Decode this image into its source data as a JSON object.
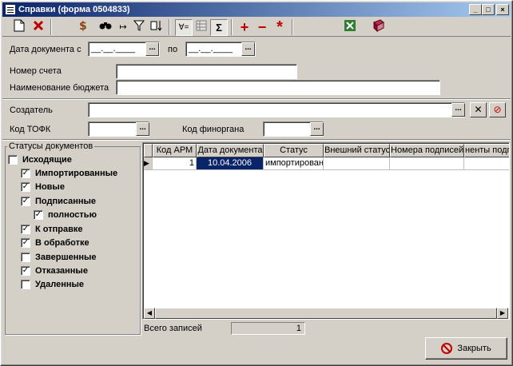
{
  "window": {
    "title": "Справки (форма 0504833)"
  },
  "toolbar": {
    "icons": [
      "new-document-icon",
      "delete-icon",
      "money-icon",
      "find-icon",
      "filter-icon",
      "sort-icon",
      "column-filter-icon",
      "grid-settings-icon",
      "sum-icon",
      "add-icon",
      "remove-icon",
      "asterisk-icon",
      "excel-icon",
      "book-icon"
    ],
    "sum_glyph": "Σ",
    "filter_glyph": "∀=",
    "add_glyph": "+",
    "remove_glyph": "−",
    "star_glyph": "*"
  },
  "form": {
    "date_label": "Дата документа с",
    "date_from_value": "__.__.____",
    "date_to_label": "по",
    "date_to_value": "__.__.____",
    "account_label": "Номер счета",
    "account_value": "",
    "budget_label": "Наименование бюджета",
    "budget_value": "",
    "creator_label": "Создатель",
    "creator_value": "",
    "tofk_label": "Код ТОФК",
    "tofk_value": "",
    "finorgan_label": "Код финоргана",
    "finorgan_value": "",
    "dots": "..."
  },
  "statuses": {
    "title": "Статусы документов",
    "items": [
      {
        "label": "Исходящие",
        "checked": false,
        "mark": ""
      },
      {
        "label": "Импортированные",
        "checked": true,
        "mark": "✓"
      },
      {
        "label": "Новые",
        "checked": true,
        "mark": "✓"
      },
      {
        "label": "Подписанные",
        "checked": true,
        "mark": "✓"
      },
      {
        "label": "полностью",
        "checked": true,
        "mark": "✓"
      },
      {
        "label": "К отправке",
        "checked": true,
        "mark": "✓"
      },
      {
        "label": "В обработке",
        "checked": true,
        "mark": "✓"
      },
      {
        "label": "Завершенные",
        "checked": false,
        "mark": ""
      },
      {
        "label": "Отказанные",
        "checked": true,
        "mark": "✓"
      },
      {
        "label": "Удаленные",
        "checked": false,
        "mark": ""
      }
    ]
  },
  "grid": {
    "columns": [
      "Код АРМ",
      "Дата документа",
      "Статус",
      "Внешний статус",
      "Номера подписей",
      "ненты подпи"
    ],
    "rows": [
      {
        "indicator": "▶",
        "cells": [
          "1",
          "10.04.2006",
          "импортирован",
          "",
          "",
          ""
        ]
      }
    ]
  },
  "status_bar": {
    "total_label": "Всего записей",
    "total_value": "1"
  },
  "buttons": {
    "close_label": "Закрыть"
  }
}
